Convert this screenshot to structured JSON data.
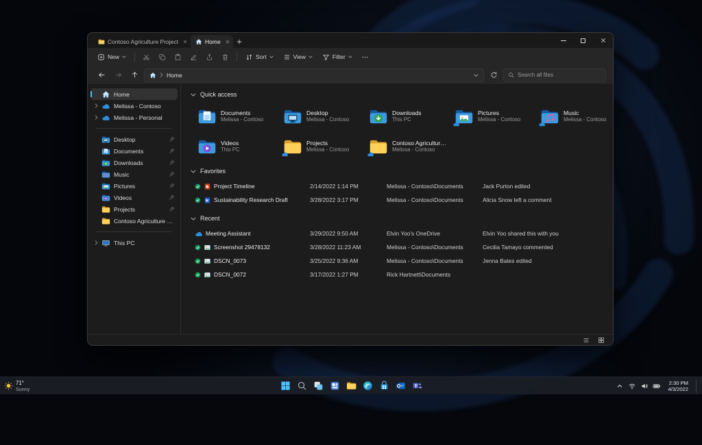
{
  "colors": {
    "accent": "#4cc2ff",
    "folder_yellow": "#ffd159",
    "onedrive_blue": "#2f8ee0",
    "status_green": "#0f9d58"
  },
  "window": {
    "tabs": [
      {
        "label": "Contoso Agriculture Project",
        "icon": "folder",
        "active": false
      },
      {
        "label": "Home",
        "icon": "home",
        "active": true
      }
    ]
  },
  "toolbar": {
    "new_label": "New",
    "sort_label": "Sort",
    "view_label": "View",
    "filter_label": "Filter"
  },
  "navbar": {
    "breadcrumb": "Home",
    "search_placeholder": "Search all files"
  },
  "sidebar": {
    "items": [
      {
        "label": "Home",
        "icon": "home",
        "selected": true
      },
      {
        "label": "Melissa - Contoso",
        "icon": "cloud",
        "expandable": true
      },
      {
        "label": "Melissa - Personal",
        "icon": "cloud",
        "expandable": true
      },
      {
        "divider": true
      },
      {
        "label": "Desktop",
        "icon": "desktop",
        "pinned": true
      },
      {
        "label": "Documents",
        "icon": "documents",
        "pinned": true
      },
      {
        "label": "Downloads",
        "icon": "downloads",
        "pinned": true
      },
      {
        "label": "Music",
        "icon": "music",
        "pinned": true
      },
      {
        "label": "Pictures",
        "icon": "pictures",
        "pinned": true
      },
      {
        "label": "Videos",
        "icon": "videos",
        "pinned": true
      },
      {
        "label": "Projects",
        "icon": "folder",
        "pinned": true
      },
      {
        "label": "Contoso Agriculture Project",
        "icon": "folder",
        "pinned": false
      },
      {
        "divider": true
      },
      {
        "label": "This PC",
        "icon": "pc",
        "expandable": true
      }
    ]
  },
  "sections": {
    "quick_access": {
      "title": "Quick access",
      "tiles": [
        {
          "name": "Documents",
          "location": "Melissa - Contoso",
          "icon": "documents",
          "cloud": false
        },
        {
          "name": "Desktop",
          "location": "Melissa - Contoso",
          "icon": "desktop",
          "cloud": false
        },
        {
          "name": "Downloads",
          "location": "This PC",
          "icon": "downloads",
          "cloud": false
        },
        {
          "name": "Pictures",
          "location": "Melissa - Contoso",
          "icon": "pictures",
          "cloud": true
        },
        {
          "name": "Music",
          "location": "Melissa - Contoso",
          "icon": "music",
          "cloud": true
        },
        {
          "name": "Videos",
          "location": "This PC",
          "icon": "videos",
          "cloud": false
        },
        {
          "name": "Projects",
          "location": "Melissa - Contoso",
          "icon": "folder",
          "cloud": true
        },
        {
          "name": "Contoso Agriculture Project",
          "location": "Melissa - Contoso",
          "icon": "folder",
          "cloud": true
        }
      ]
    },
    "favorites": {
      "title": "Favorites",
      "rows": [
        {
          "name": "Project Timeline",
          "icon": "ppt",
          "status": "synced",
          "date": "2/14/2022 1:14 PM",
          "location": "Melissa - Contoso\\Documents",
          "activity": "Jack Purton edited"
        },
        {
          "name": "Sustainability Research Draft",
          "icon": "word",
          "status": "synced",
          "date": "3/28/2022 3:17 PM",
          "location": "Melissa - Contoso\\Documents",
          "activity": "Alicia Snow left a comment"
        }
      ]
    },
    "recent": {
      "title": "Recent",
      "rows": [
        {
          "name": "Meeting Assistant",
          "icon": null,
          "status": "cloud",
          "date": "3/29/2022 9:50 AM",
          "location": "Elvin Yoo's OneDrive",
          "activity": "Elvin Yoo shared this with you"
        },
        {
          "name": "Screenshot 29478132",
          "icon": "image",
          "status": "synced",
          "date": "3/28/2022 11:23 AM",
          "location": "Melissa - Contoso\\Documents",
          "activity": "Cecilia Tamayo commented"
        },
        {
          "name": "DSCN_0073",
          "icon": "image",
          "status": "synced",
          "date": "3/25/2022 9:36 AM",
          "location": "Melissa - Contoso\\Documents",
          "activity": "Jenna Bates edited"
        },
        {
          "name": "DSCN_0072",
          "icon": "image",
          "status": "synced",
          "date": "3/17/2022 1:27 PM",
          "location": "Rick Hartnett\\Documents",
          "activity": ""
        }
      ]
    }
  },
  "taskbar": {
    "weather": {
      "temp": "71°",
      "condition": "Sunny"
    },
    "icons": [
      "start",
      "search",
      "task-view",
      "widgets",
      "file-explorer",
      "edge",
      "store",
      "outlook",
      "teams"
    ],
    "tray_icons": [
      "chevron-up",
      "wifi",
      "volume",
      "battery"
    ],
    "tray": {
      "time": "2:30 PM",
      "date": "4/3/2022"
    }
  }
}
